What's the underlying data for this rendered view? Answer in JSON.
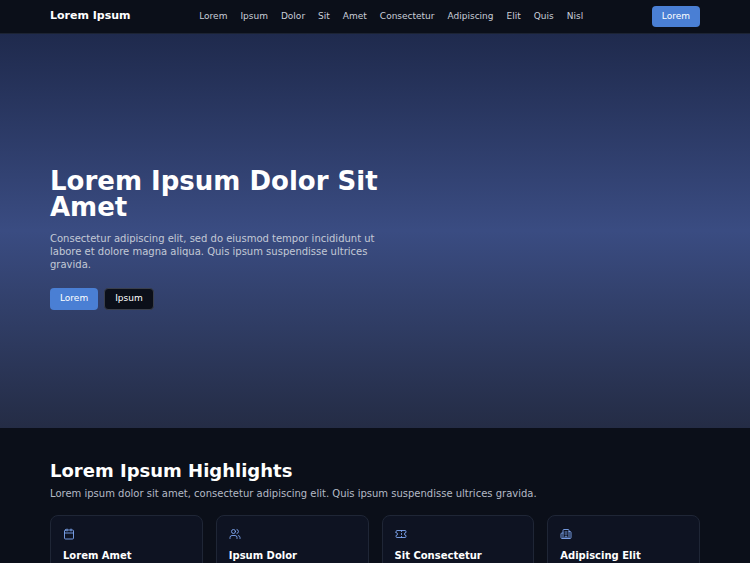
{
  "nav": {
    "logo": "Lorem Ipsum",
    "links": [
      "Lorem",
      "Ipsum",
      "Dolor",
      "Sit",
      "Amet",
      "Consectetur",
      "Adipiscing",
      "Elit",
      "Quis",
      "Nisl"
    ],
    "button": "Lorem"
  },
  "hero": {
    "title": "Lorem Ipsum Dolor Sit Amet",
    "text": "Consectetur adipiscing elit, sed do eiusmod tempor incididunt ut labore et dolore magna aliqua. Quis ipsum suspendisse ultrices gravida.",
    "buttons": [
      {
        "label": "Lorem",
        "kind": "primary"
      },
      {
        "label": "Ipsum",
        "kind": "secondary"
      }
    ]
  },
  "highlights": {
    "title": "Lorem Ipsum Highlights",
    "text": "Lorem ipsum dolor sit amet, consectetur adipiscing elit. Quis ipsum suspendisse ultrices gravida.",
    "cards": [
      {
        "title": "Lorem Amet"
      },
      {
        "title": "Ipsum Dolor"
      },
      {
        "title": "Sit Consectetur"
      },
      {
        "title": "Adipiscing Elit"
      }
    ]
  }
}
